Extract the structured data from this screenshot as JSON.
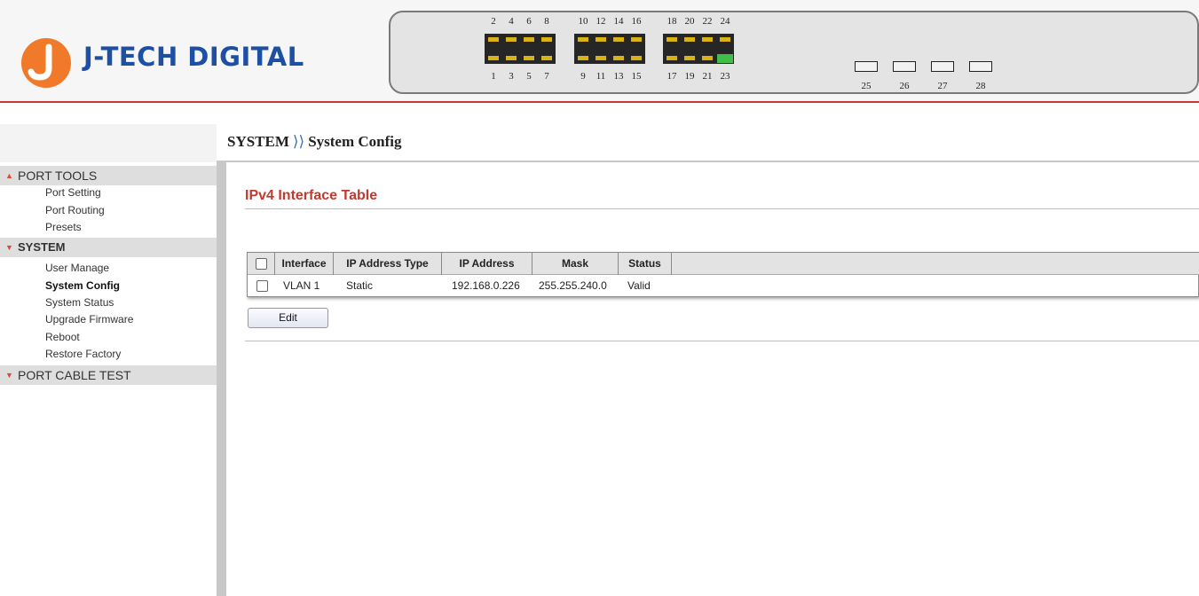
{
  "brand": {
    "name": "J-TECH DIGITAL",
    "logo_color": "#1d4fa3",
    "mark_color": "#f07a2a",
    "accent_line": "#c9373c"
  },
  "switch_panel": {
    "top_port_numbers": [
      "2",
      "4",
      "6",
      "8",
      "10",
      "12",
      "14",
      "16",
      "18",
      "20",
      "22",
      "24"
    ],
    "bottom_port_numbers": [
      "1",
      "3",
      "5",
      "7",
      "9",
      "11",
      "13",
      "15",
      "17",
      "19",
      "21",
      "23"
    ],
    "active_port": "23",
    "active_port_color": "#3fbf4a",
    "sfp_ports": [
      "25",
      "26",
      "27",
      "28"
    ]
  },
  "breadcrumb": {
    "section": "SYSTEM",
    "separator": "⟩⟩",
    "page": "System Config"
  },
  "sidebar": {
    "groups": [
      {
        "label": "PORT TOOLS",
        "expanded": true,
        "items": [
          "Port Setting",
          "Port Routing",
          "Presets"
        ]
      },
      {
        "label": "SYSTEM",
        "expanded": true,
        "items": [
          "User Manage",
          "System Config",
          "System Status",
          "Upgrade Firmware",
          "Reboot",
          "Restore Factory"
        ],
        "active_item": "System Config"
      },
      {
        "label": "PORT CABLE TEST",
        "expanded": false,
        "items": []
      }
    ]
  },
  "main": {
    "title": "IPv4 Interface Table",
    "title_color": "#c13a2f",
    "table": {
      "columns": [
        "Interface",
        "IP Address Type",
        "IP Address",
        "Mask",
        "Status"
      ],
      "rows": [
        {
          "checked": false,
          "interface": "VLAN 1",
          "ip_address_type": "Static",
          "ip_address": "192.168.0.226",
          "mask": "255.255.240.0",
          "status": "Valid"
        }
      ]
    },
    "edit_button": "Edit"
  }
}
